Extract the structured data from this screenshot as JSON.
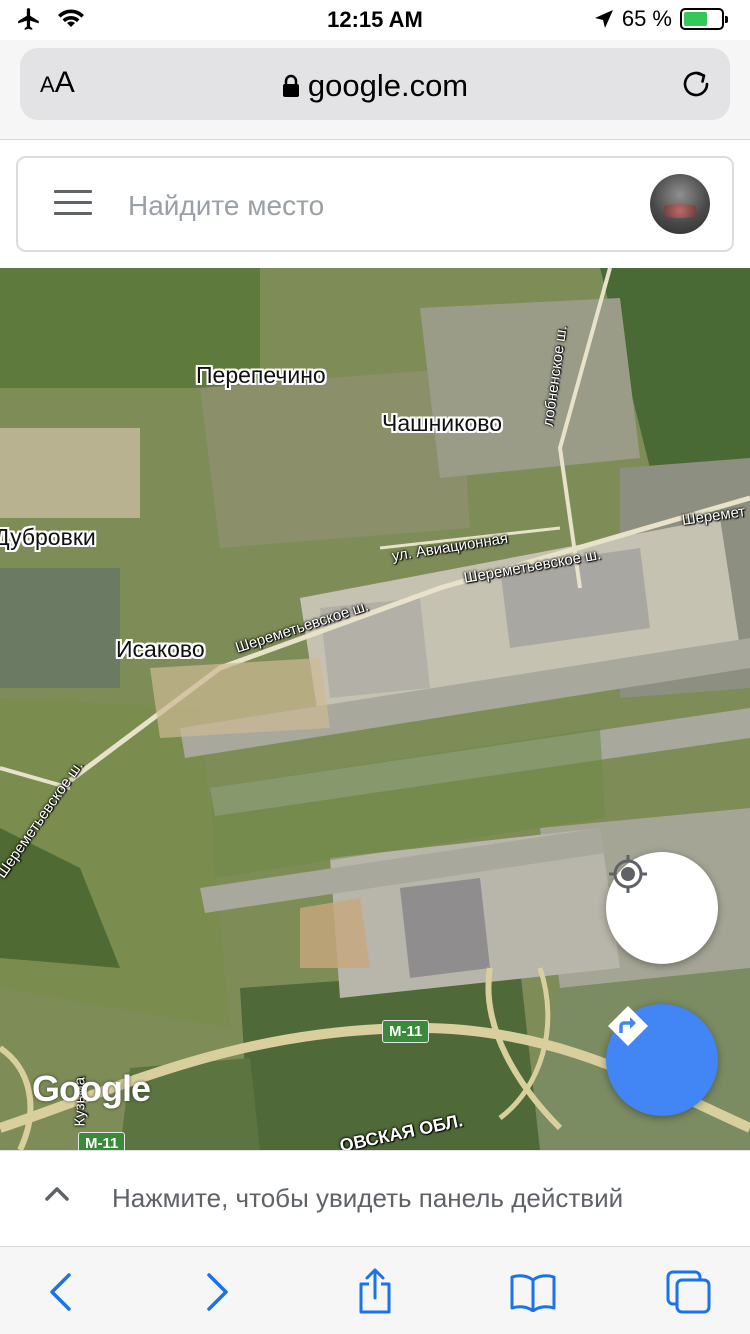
{
  "status_bar": {
    "time": "12:15 AM",
    "battery_percent": "65 %",
    "battery_level": 0.65,
    "icons": [
      "airplane-icon",
      "wifi-icon",
      "location-arrow-icon",
      "battery-icon"
    ]
  },
  "browser": {
    "text_size_label_small": "A",
    "text_size_label_large": "A",
    "url": "google.com"
  },
  "search": {
    "placeholder": "Найдите место"
  },
  "map": {
    "place_labels": {
      "perepechino": "Перепечино",
      "chashnikovo": "Чашниково",
      "dubrovki": "Дубровки",
      "isakovo": "Исаково"
    },
    "road_labels": {
      "lobnenskoe": "лобненское ш.",
      "aviatsionnaya": "ул. Авиационная",
      "sheremetyevskoe_1": "Шереметьевское ш.",
      "sheremetyevskoe_2": "Шереметьевское ш.",
      "sheremetyevskoe_3": "Шереметьевское ш.",
      "sheremet_right": "Шеремет",
      "kuzma": "Кузьма",
      "moskovskaya_obl": "ОВСКАЯ ОБЛ."
    },
    "highway_shields": [
      "M-11",
      "M-11"
    ],
    "logo": "Google"
  },
  "action_panel": {
    "text": "Нажмите, чтобы увидеть панель действий"
  },
  "colors": {
    "accent": "#4285f4",
    "safari_blue": "#1a73e8",
    "highway_green": "#3a8a3a"
  }
}
